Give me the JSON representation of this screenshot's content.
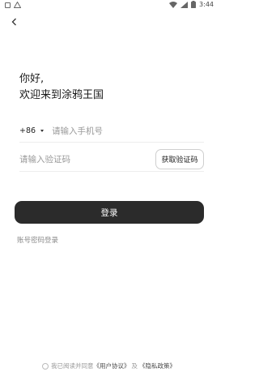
{
  "status_bar": {
    "time": "3:44"
  },
  "greeting": {
    "line1": "你好,",
    "line2": "欢迎来到涂鸦王国"
  },
  "phone": {
    "country_code": "+86",
    "placeholder": "请输入手机号"
  },
  "code": {
    "placeholder": "请输入验证码",
    "get_code_label": "获取验证码"
  },
  "login": {
    "button_label": "登录",
    "alt_login_label": "账号密码登录"
  },
  "agreement": {
    "prefix": "我已阅读并同意",
    "user_agreement": "《用户协议》",
    "conjunction": "及",
    "privacy_policy": "《隐私政策》"
  }
}
